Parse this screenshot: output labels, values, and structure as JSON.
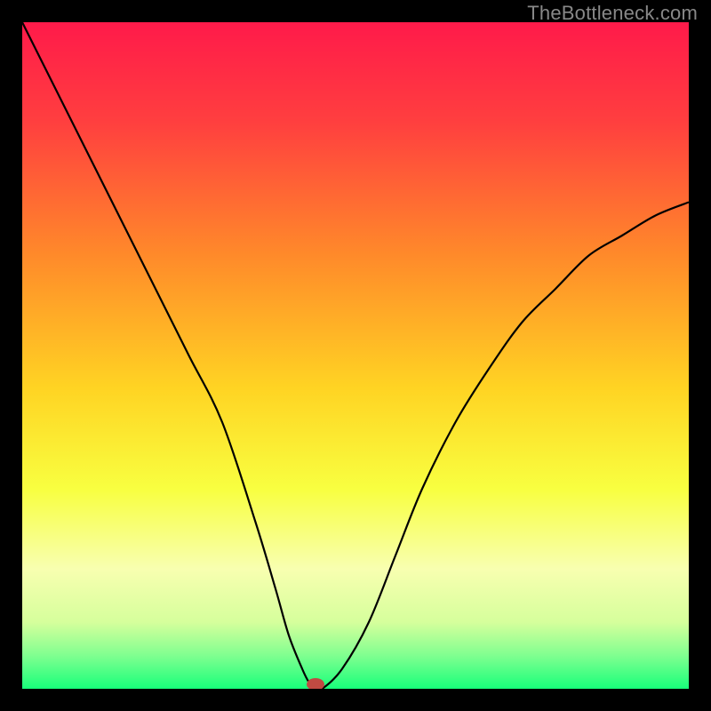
{
  "watermark": "TheBottleneck.com",
  "chart_data": {
    "type": "line",
    "title": "",
    "xlabel": "",
    "ylabel": "",
    "xlim": [
      0,
      100
    ],
    "ylim": [
      0,
      100
    ],
    "background_gradient": {
      "stops": [
        {
          "offset": 0.0,
          "color": "#ff1a4a"
        },
        {
          "offset": 0.15,
          "color": "#ff3f3f"
        },
        {
          "offset": 0.35,
          "color": "#ff8a2a"
        },
        {
          "offset": 0.55,
          "color": "#ffd423"
        },
        {
          "offset": 0.7,
          "color": "#f8ff40"
        },
        {
          "offset": 0.82,
          "color": "#f8ffb0"
        },
        {
          "offset": 0.9,
          "color": "#d6ff9c"
        },
        {
          "offset": 0.95,
          "color": "#80ff90"
        },
        {
          "offset": 1.0,
          "color": "#18ff7a"
        }
      ]
    },
    "series": [
      {
        "name": "bottleneck-curve",
        "color": "#000000",
        "x": [
          0,
          5,
          10,
          15,
          20,
          25,
          30,
          35,
          38,
          40,
          42,
          43,
          44,
          45,
          48,
          52,
          56,
          60,
          65,
          70,
          75,
          80,
          85,
          90,
          95,
          100
        ],
        "values": [
          100,
          90,
          80,
          70,
          60,
          50,
          40,
          25,
          15,
          8,
          3,
          1,
          0,
          0,
          3,
          10,
          20,
          30,
          40,
          48,
          55,
          60,
          65,
          68,
          71,
          73
        ]
      }
    ],
    "marker": {
      "name": "bottleneck-point",
      "x": 44,
      "y": 0,
      "color": "#c04a42",
      "rx": 10,
      "ry": 7
    }
  }
}
